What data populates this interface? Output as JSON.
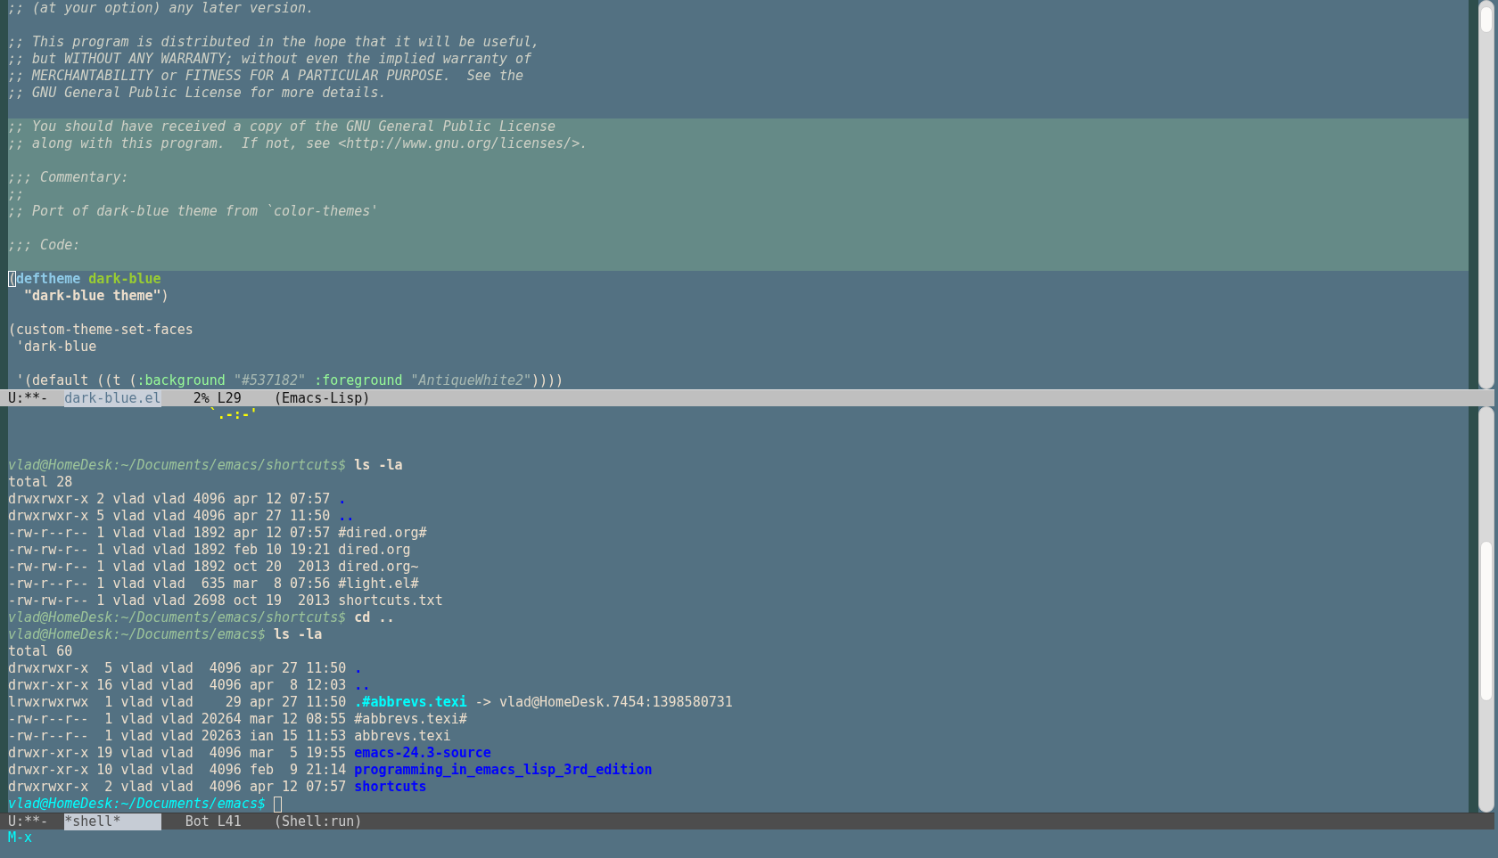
{
  "top_window": {
    "lines": [
      {
        "region": false,
        "segments": [
          {
            "text": ";; (at your option) any later version.",
            "kind": "comment"
          }
        ]
      },
      {
        "region": false
      },
      {
        "region": false,
        "segments": [
          {
            "text": ";; This program is distributed in the hope that it will be useful,",
            "kind": "comment"
          }
        ]
      },
      {
        "region": false,
        "segments": [
          {
            "text": ";; but WITHOUT ANY WARRANTY; without even the implied warranty of",
            "kind": "comment"
          }
        ]
      },
      {
        "region": false,
        "segments": [
          {
            "text": ";; MERCHANTABILITY or FITNESS FOR A PARTICULAR PURPOSE.  See the",
            "kind": "comment"
          }
        ]
      },
      {
        "region": false,
        "segments": [
          {
            "text": ";; GNU General Public License for more details.",
            "kind": "comment"
          }
        ]
      },
      {
        "region": false
      },
      {
        "region": true,
        "segments": [
          {
            "text": ";; You should have received a copy of the GNU General Public License",
            "kind": "comment"
          }
        ]
      },
      {
        "region": true,
        "segments": [
          {
            "text": ";; along with this program.  If not, see <http://www.gnu.org/licenses/>.",
            "kind": "comment"
          }
        ]
      },
      {
        "region": true
      },
      {
        "region": true,
        "segments": [
          {
            "text": ";;; Commentary:",
            "kind": "comment"
          }
        ]
      },
      {
        "region": true,
        "segments": [
          {
            "text": ";;",
            "kind": "comment"
          }
        ]
      },
      {
        "region": true,
        "segments": [
          {
            "text": ";; Port of dark-blue theme from `color-themes'",
            "kind": "comment"
          }
        ]
      },
      {
        "region": true
      },
      {
        "region": true,
        "segments": [
          {
            "text": ";;; Code:",
            "kind": "comment"
          }
        ]
      },
      {
        "region": true
      },
      {
        "region": false,
        "segments": [
          {
            "text": "(",
            "kind": "cursor"
          },
          {
            "text": "deftheme",
            "kind": "keyword"
          },
          {
            "text": " dark-blue",
            "kind": "function"
          }
        ]
      },
      {
        "region": false,
        "segments": [
          {
            "text": "  \"dark-blue theme\"",
            "kind": "doc"
          },
          {
            "text": ")",
            "kind": "plain"
          }
        ]
      },
      {
        "region": false
      },
      {
        "region": false,
        "segments": [
          {
            "text": "(custom-theme-set-faces",
            "kind": "plain"
          }
        ]
      },
      {
        "region": false,
        "segments": [
          {
            "text": " 'dark-blue",
            "kind": "plain"
          }
        ]
      },
      {
        "region": false
      },
      {
        "region": false,
        "segments": [
          {
            "text": " '(default ((t (",
            "kind": "plain"
          },
          {
            "text": ":background ",
            "kind": "builtin"
          },
          {
            "text": "\"#537182\" ",
            "kind": "string"
          },
          {
            "text": ":foreground ",
            "kind": "builtin"
          },
          {
            "text": "\"AntiqueWhite2\"",
            "kind": "string"
          },
          {
            "text": "))))",
            "kind": "plain"
          }
        ]
      }
    ]
  },
  "top_mode_line": {
    "active": true,
    "status": "U:**-",
    "buffer": "dark-blue.el",
    "position": "2% L29",
    "mode": "(Emacs-Lisp)"
  },
  "shell": {
    "cursor_after_last_line": true,
    "lines": [
      {
        "segments": [
          {
            "text": "                         `.-:-'",
            "kind": "warning"
          }
        ]
      },
      {
        "segments": [
          {
            "text": "vlad@HomeDesk:~/Documents/emacs/shortcuts$",
            "kind": "prompt"
          },
          {
            "text": " ls -la",
            "kind": "input"
          }
        ]
      },
      {
        "segments": [
          {
            "text": "total 28",
            "kind": "plain"
          }
        ]
      },
      {
        "segments": [
          {
            "text": "drwxrwxr-x 2 vlad vlad 4096 apr 12 07:57 ",
            "kind": "plain"
          },
          {
            "text": ".",
            "kind": "dir"
          }
        ]
      },
      {
        "segments": [
          {
            "text": "drwxrwxr-x 5 vlad vlad 4096 apr 27 11:50 ",
            "kind": "plain"
          },
          {
            "text": "..",
            "kind": "dir"
          }
        ]
      },
      {
        "segments": [
          {
            "text": "-rw-r--r-- 1 vlad vlad 1892 apr 12 07:57 #dired.org#",
            "kind": "plain"
          }
        ]
      },
      {
        "segments": [
          {
            "text": "-rw-rw-r-- 1 vlad vlad 1892 feb 10 19:21 dired.org",
            "kind": "plain"
          }
        ]
      },
      {
        "segments": [
          {
            "text": "-rw-rw-r-- 1 vlad vlad 1892 oct 20  2013 dired.org~",
            "kind": "plain"
          }
        ]
      },
      {
        "segments": [
          {
            "text": "-rw-r--r-- 1 vlad vlad  635 mar  8 07:56 #light.el#",
            "kind": "plain"
          }
        ]
      },
      {
        "segments": [
          {
            "text": "-rw-rw-r-- 1 vlad vlad 2698 oct 19  2013 shortcuts.txt",
            "kind": "plain"
          }
        ]
      },
      {
        "segments": [
          {
            "text": "vlad@HomeDesk:~/Documents/emacs/shortcuts$",
            "kind": "prompt"
          },
          {
            "text": " cd ..",
            "kind": "input"
          }
        ]
      },
      {
        "segments": [
          {
            "text": "vlad@HomeDesk:~/Documents/emacs$",
            "kind": "prompt"
          },
          {
            "text": " ls -la",
            "kind": "input"
          }
        ]
      },
      {
        "segments": [
          {
            "text": "total 60",
            "kind": "plain"
          }
        ]
      },
      {
        "segments": [
          {
            "text": "drwxrwxr-x  5 vlad vlad  4096 apr 27 11:50 ",
            "kind": "plain"
          },
          {
            "text": ".",
            "kind": "dir"
          }
        ]
      },
      {
        "segments": [
          {
            "text": "drwxr-xr-x 16 vlad vlad  4096 apr  8 12:03 ",
            "kind": "plain"
          },
          {
            "text": "..",
            "kind": "dir"
          }
        ]
      },
      {
        "segments": [
          {
            "text": "lrwxrwxrwx  1 vlad vlad    29 apr 27 11:50 ",
            "kind": "plain"
          },
          {
            "text": ".#abbrevs.texi",
            "kind": "symlink"
          },
          {
            "text": " -> vlad@HomeDesk.7454:1398580731",
            "kind": "plain"
          }
        ]
      },
      {
        "segments": [
          {
            "text": "-rw-r--r--  1 vlad vlad 20264 mar 12 08:55 #abbrevs.texi#",
            "kind": "plain"
          }
        ]
      },
      {
        "segments": [
          {
            "text": "-rw-r--r--  1 vlad vlad 20263 ian 15 11:53 abbrevs.texi",
            "kind": "plain"
          }
        ]
      },
      {
        "segments": [
          {
            "text": "drwxr-xr-x 19 vlad vlad  4096 mar  5 19:55 ",
            "kind": "plain"
          },
          {
            "text": "emacs-24.3-source",
            "kind": "dir"
          }
        ]
      },
      {
        "segments": [
          {
            "text": "drwxr-xr-x 10 vlad vlad  4096 feb  9 21:14 ",
            "kind": "plain"
          },
          {
            "text": "programming_in_emacs_lisp_3rd_edition",
            "kind": "dir"
          }
        ]
      },
      {
        "segments": [
          {
            "text": "drwxrwxr-x  2 vlad vlad  4096 apr 12 07:57 ",
            "kind": "plain"
          },
          {
            "text": "shortcuts",
            "kind": "dir"
          }
        ]
      },
      {
        "segments": [
          {
            "text": "vlad@HomeDesk:~/Documents/emacs$",
            "kind": "current-prompt"
          }
        ]
      }
    ]
  },
  "shell_mode_line": {
    "active": false,
    "status": "U:**-",
    "buffer": "*shell*",
    "position": "Bot L41",
    "mode": "(Shell:run)"
  },
  "minibuffer": {
    "text": "M-x"
  }
}
